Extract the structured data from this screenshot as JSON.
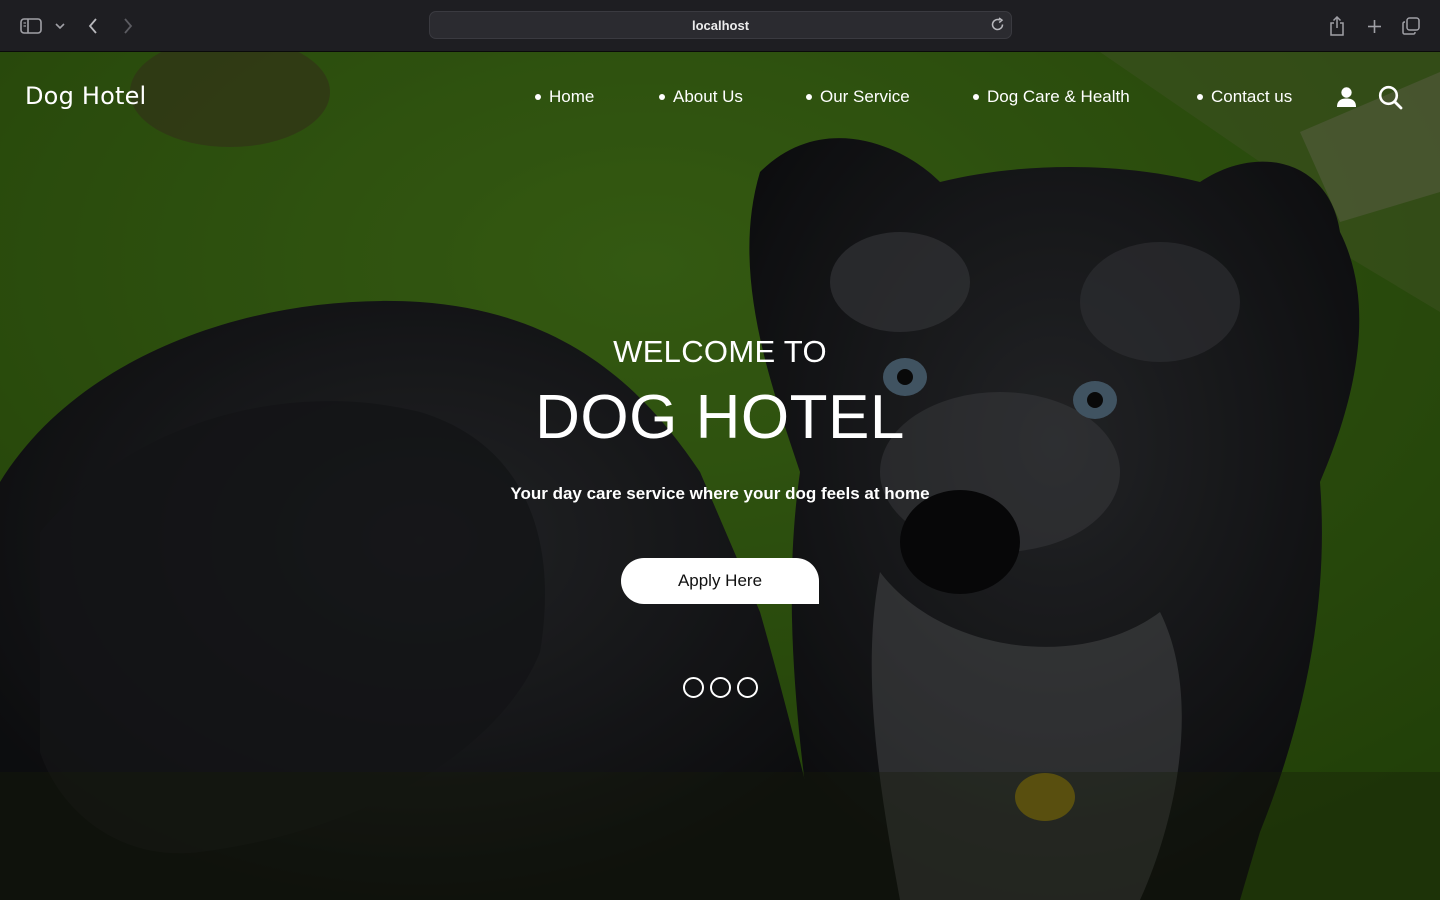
{
  "browser": {
    "url": "localhost",
    "icons": [
      "sidebar-icon",
      "chevron-down-icon",
      "back-icon",
      "forward-icon",
      "reload-icon",
      "share-icon",
      "plus-icon",
      "tabs-icon"
    ]
  },
  "site": {
    "brand": "Dog Hotel",
    "nav": [
      {
        "label": "Home"
      },
      {
        "label": "About Us"
      },
      {
        "label": "Our Service"
      },
      {
        "label": "Dog Care & Health"
      },
      {
        "label": "Contact us"
      }
    ],
    "nav_icons": [
      "user-icon",
      "search-icon"
    ]
  },
  "hero": {
    "welcome": "WELCOME TO",
    "title": "DOG HOTEL",
    "subtitle": "Your day care service where your dog feels at home",
    "cta_label": "Apply Here",
    "slides": 3,
    "background": "green backdrop with a merle shepherd dog"
  },
  "colors": {
    "text": "#ffffff",
    "chrome": "#1e1e22",
    "cta_bg": "#ffffff",
    "backdrop_green": "#4f8a1c"
  }
}
